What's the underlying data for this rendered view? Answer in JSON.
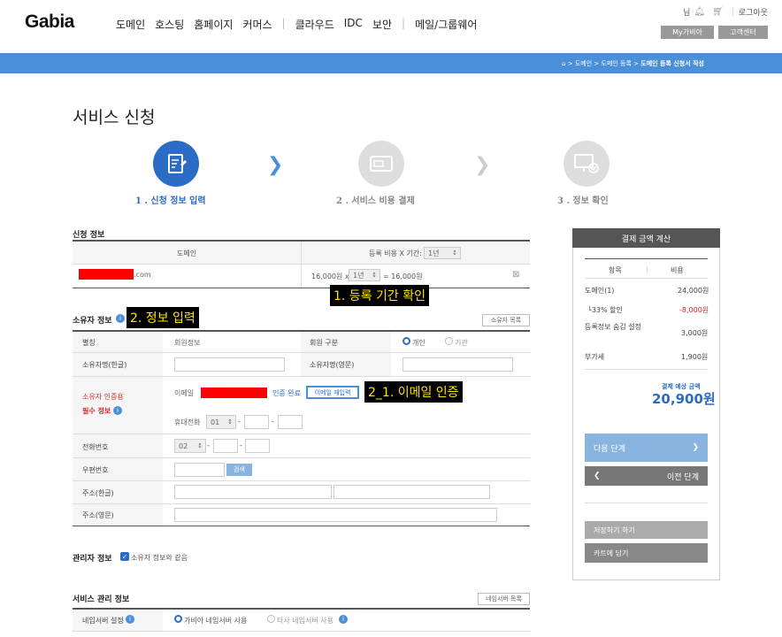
{
  "header": {
    "logo": "Gabia",
    "nav": [
      "도메인",
      "호스팅",
      "홈페이지",
      "커머스",
      "클라우드",
      "IDC",
      "보안",
      "메일/그룹웨어"
    ],
    "user_suffix": "님",
    "logout": "로그아웃",
    "my_gabia": "My가비아",
    "customer_center": "고객센터"
  },
  "breadcrumb": {
    "items": [
      "도메인",
      "도메인 등록"
    ],
    "current": "도메인 등록 신청서 작성",
    "sep": ">"
  },
  "page_title": "서비스 신청",
  "steps": [
    {
      "label": "1 . 신청 정보 입력",
      "active": true
    },
    {
      "label": "2 . 서비스 비용 결제",
      "active": false
    },
    {
      "label": "3 . 정보 확인",
      "active": false
    }
  ],
  "application": {
    "title": "신청 정보",
    "col_domain": "도메인",
    "col_period": "등록 비용 X 기간:",
    "period_value": "1년",
    "domain_suffix": ".com",
    "price_text": "16,000원 x",
    "row_period": "1년",
    "total_text": "= 16,000원",
    "remove_icon": "⊠"
  },
  "annotations": {
    "period_check": "1. 등록 기간 확인",
    "info_input": "2. 정보 입력",
    "email_verify": "2_1. 이메일 인증"
  },
  "owner": {
    "title": "소유자 정보",
    "list_btn": "소유자 목록",
    "alias_label": "별칭",
    "alias_value": "회원정보",
    "type_label": "회원 구분",
    "type_personal": "개인",
    "type_org": "기관",
    "name_kr_label": "소유자명(한글)",
    "name_en_label": "소유자명(영문)",
    "verify_label_1": "소유자 인증용",
    "verify_label_2": "필수 정보",
    "email_label": "이메일",
    "verified_text": "인증 완료",
    "email_reenter": "이메일 재입력",
    "mobile_label": "휴대전화",
    "mobile_prefix": "01",
    "phone_label": "전화번호",
    "phone_prefix": "02",
    "zip_label": "우편번호",
    "zip_btn": "검색",
    "addr_kr_label": "주소(한글)",
    "addr_en_label": "주소(영문)",
    "dash": "-"
  },
  "admin": {
    "title": "관리자 정보",
    "same_as_owner": "소유자 정보와 같음"
  },
  "service": {
    "title": "서비스 관리 정보",
    "ns_list_btn": "네임서버 목록",
    "ns_label": "네임서버 설정",
    "ns_gabia": "가비아 네임서버 사용",
    "ns_other": "타사 네임서버 사용"
  },
  "calc": {
    "title": "결제 금액 계산",
    "col_item": "항목",
    "col_cost": "비용",
    "rows": [
      {
        "item": "도메인(1)",
        "cost": "24,000원"
      },
      {
        "item": "└33% 할인",
        "cost": "-8,000원"
      },
      {
        "item": "등록정보 숨김 설정",
        "cost": "3,000원"
      },
      {
        "item": "부가세",
        "cost": "1,900원"
      }
    ],
    "expected_label": "결제 예상 금액",
    "expected_value": "20,900원",
    "next_btn": "다음 단계",
    "prev_btn": "이전 단계",
    "save_btn": "저장하기 하기",
    "cart_btn": "카트에 담기"
  },
  "colors": {
    "accent": "#4a90d9",
    "dark": "#555555",
    "danger": "#e02020",
    "highlight": "#ffe400"
  }
}
